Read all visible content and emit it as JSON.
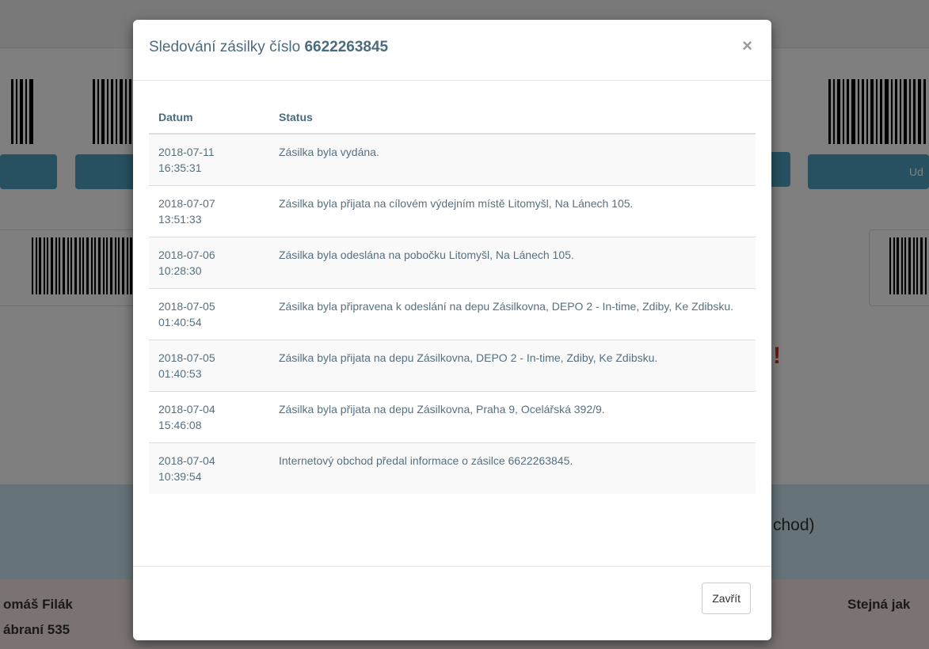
{
  "background": {
    "button_right_label": "Ud",
    "warning_text": "!",
    "info_text": "chod)",
    "address_left_name": "omáš Filák",
    "address_left_street": "ábraní 535",
    "address_right": "Stejná jak"
  },
  "modal": {
    "title_prefix": "Sledování zásilky číslo",
    "tracking_number": "6622263845",
    "close_icon": "×",
    "table": {
      "headers": [
        "Datum",
        "Status"
      ],
      "rows": [
        {
          "date": "2018-07-11",
          "time": "16:35:31",
          "status": "Zásilka byla vydána."
        },
        {
          "date": "2018-07-07",
          "time": "13:51:33",
          "status": "Zásilka byla přijata na cílovém výdejním místě Litomyšl, Na Lánech 105."
        },
        {
          "date": "2018-07-06",
          "time": "10:28:30",
          "status": "Zásilka byla odeslána na pobočku Litomyšl, Na Lánech 105."
        },
        {
          "date": "2018-07-05",
          "time": "01:40:54",
          "status": "Zásilka byla připravena k odeslání na depu Zásilkovna, DEPO 2 - In-time, Zdiby, Ke Zdibsku."
        },
        {
          "date": "2018-07-05",
          "time": "01:40:53",
          "status": "Zásilka byla přijata na depu Zásilkovna, DEPO 2 - In-time, Zdiby, Ke Zdibsku."
        },
        {
          "date": "2018-07-04",
          "time": "15:46:08",
          "status": "Zásilka byla přijata na depu Zásilkovna, Praha 9, Ocelářská 392/9."
        },
        {
          "date": "2018-07-04",
          "time": "10:39:54",
          "status": "Internetový obchod předal informace o zásilce 6622263845."
        }
      ]
    },
    "footer": {
      "close_button_label": "Zavřít"
    }
  },
  "colors": {
    "accent": "#4ea3c1",
    "title": "#4b6b7f",
    "warning": "#d33232"
  }
}
